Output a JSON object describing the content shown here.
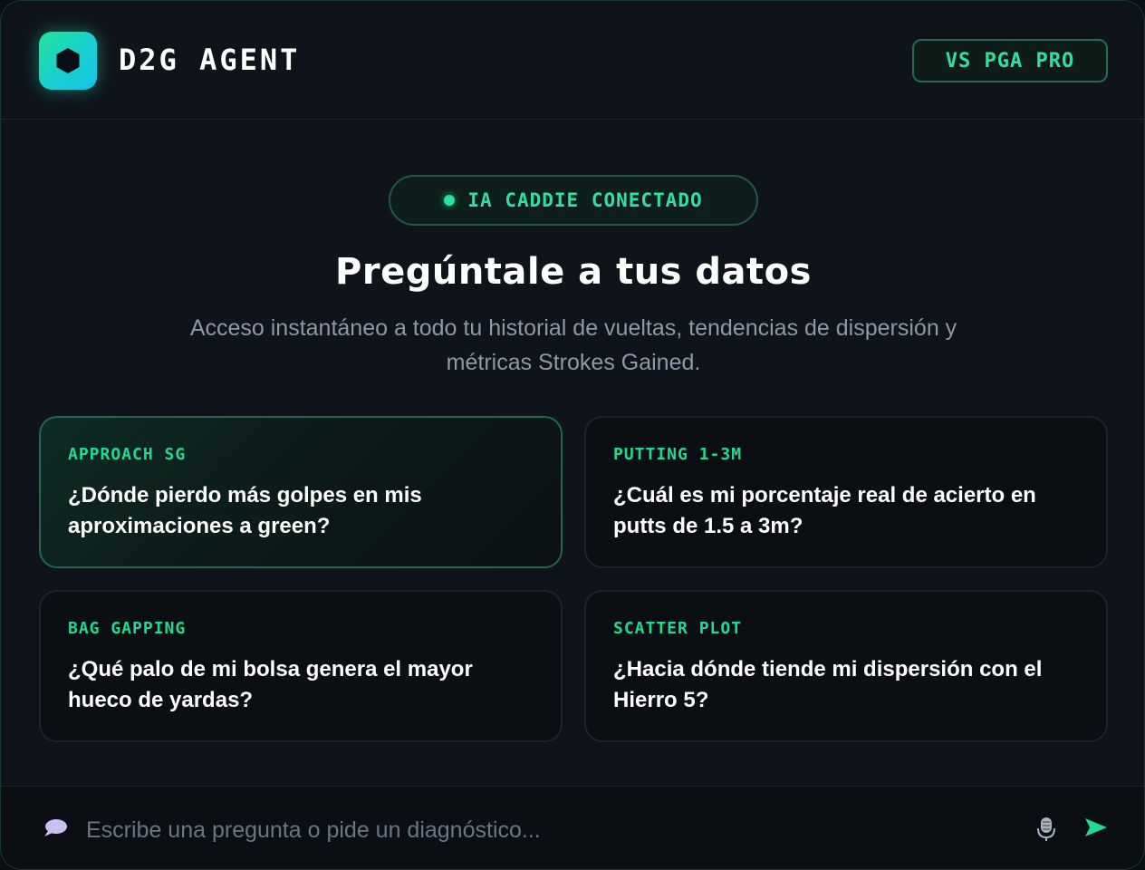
{
  "header": {
    "brand": "D2G AGENT",
    "logo_icon": "hexagon-icon",
    "compare_badge": "VS PGA PRO"
  },
  "status": {
    "label": "IA CADDIE CONECTADO",
    "color": "#27e39b"
  },
  "hero": {
    "title": "Pregúntale a tus datos",
    "subtitle": "Acceso instantáneo a todo tu historial de vueltas, tendencias de dispersión y métricas Strokes Gained."
  },
  "cards": [
    {
      "tag": "APPROACH SG",
      "question": "¿Dónde pierdo más golpes en mis aproximaciones a green?"
    },
    {
      "tag": "PUTTING 1-3M",
      "question": "¿Cuál es mi porcentaje real de acierto en putts de 1.5 a 3m?"
    },
    {
      "tag": "BAG GAPPING",
      "question": "¿Qué palo de mi bolsa genera el mayor hueco de yardas?"
    },
    {
      "tag": "SCATTER PLOT",
      "question": "¿Hacia dónde tiende mi dispersión con el Hierro 5?"
    }
  ],
  "composer": {
    "placeholder": "Escribe una pregunta o pide un diagnóstico...",
    "value": "",
    "icons": [
      "chat-bubble-icon",
      "microphone-icon",
      "send-icon"
    ]
  },
  "colors": {
    "accent": "#22d992",
    "background": "#0f141b"
  }
}
